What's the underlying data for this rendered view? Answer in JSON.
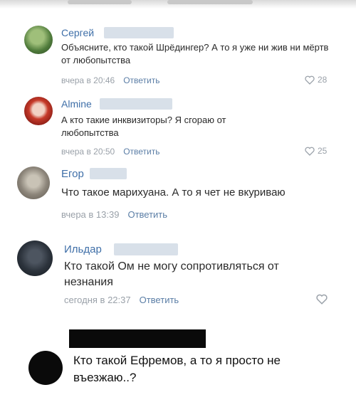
{
  "comments": [
    {
      "author": "Сергей",
      "text": "Объясните, кто такой Шрёдингер? А то я уже ни жив ни мёртв от любопытства",
      "time": "вчера в 20:46",
      "reply": "Ответить",
      "likes": "28"
    },
    {
      "author": "Almine",
      "text": "А кто такие инквизиторы? Я сгораю от любопытства",
      "time": "вчера в 20:50",
      "reply": "Ответить",
      "likes": "25"
    },
    {
      "author": "Егор",
      "text": "Что такое марихуана. А то я чет не вкуриваю",
      "time": "вчера в 13:39",
      "reply": "Ответить"
    },
    {
      "author": "Ильдар",
      "text": "Кто такой Ом не могу сопротивляться от незнания",
      "time": "сегодня в 22:37",
      "reply": "Ответить"
    }
  ],
  "final_comment": {
    "text": "Кто такой Ефремов, а то я просто не въезжаю..?"
  },
  "colors": {
    "author_link": "#3f6fa8",
    "meta_gray": "#9aa1a9",
    "reply_link": "#5b7ea6",
    "redaction": "#d8e0e9",
    "censor_black": "#0a0a0a"
  },
  "icons": [
    "heart-icon"
  ]
}
